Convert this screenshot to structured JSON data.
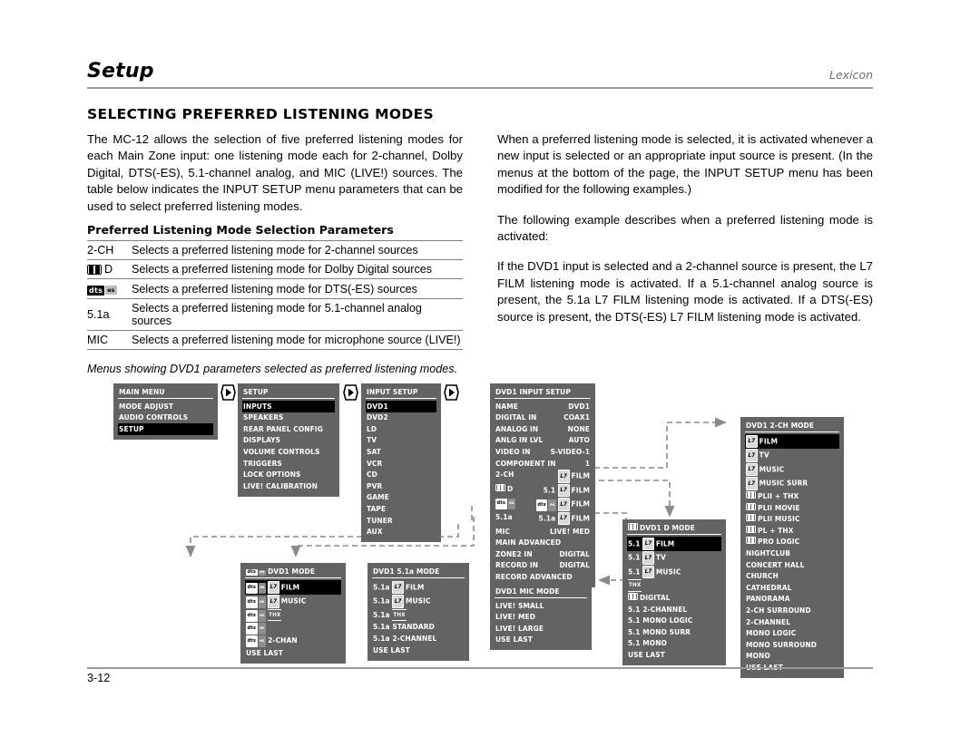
{
  "header": {
    "title": "Setup",
    "brand": "Lexicon"
  },
  "section_heading": "SELECTING PREFERRED LISTENING MODES",
  "body": {
    "left": [
      "The MC-12 allows the selection of five preferred listening modes for each Main Zone input: one listening mode each for 2-channel, Dolby Digital, DTS(-ES), 5.1-channel analog, and MIC (LIVE!) sources. The table below indicates the INPUT SETUP menu parameters that can be used to select preferred listening modes."
    ],
    "right": [
      "When a preferred listening mode is selected, it is activated whenever a new input is selected or an appropriate input source is present. (In the menus at the bottom of the page, the INPUT SETUP menu has been modified for the following examples.)",
      "The following example describes when a preferred listening mode is activated:",
      "If the DVD1 input is selected and a 2-channel source is present, the L7 FILM listening mode is activated. If a 5.1-channel analog source is present, the 5.1a L7 FILM listening mode is activated. If a DTS(-ES) source is present, the DTS(-ES) L7 FILM listening mode is activated."
    ]
  },
  "param_table": {
    "caption": "Preferred Listening Mode Selection Parameters",
    "rows": [
      {
        "key": "2-CH",
        "key_type": "text",
        "desc": "Selects a preferred listening mode for 2-channel sources"
      },
      {
        "key": "D",
        "key_type": "dolby-digital",
        "desc": "Selects a preferred listening mode for Dolby Digital sources"
      },
      {
        "key": "dts",
        "key_type": "dts-es",
        "desc": "Selects a preferred listening mode for DTS(-ES) sources"
      },
      {
        "key": "5.1a",
        "key_type": "text",
        "desc": "Selects a preferred listening mode for 5.1-channel analog sources"
      },
      {
        "key": "MIC",
        "key_type": "text",
        "desc": "Selects a preferred listening mode for microphone source (LIVE!)"
      }
    ]
  },
  "menus_caption": "Menus showing DVD1 parameters selected as preferred listening modes.",
  "menus": {
    "main_menu": {
      "title": "MAIN MENU",
      "items": [
        {
          "label": "MODE ADJUST",
          "selected": false
        },
        {
          "label": "AUDIO CONTROLS",
          "selected": false
        },
        {
          "label": "SETUP",
          "selected": true
        }
      ]
    },
    "setup": {
      "title": "SETUP",
      "items": [
        {
          "label": "INPUTS",
          "selected": true
        },
        {
          "label": "SPEAKERS",
          "selected": false
        },
        {
          "label": "REAR PANEL CONFIG",
          "selected": false
        },
        {
          "label": "DISPLAYS",
          "selected": false
        },
        {
          "label": "VOLUME CONTROLS",
          "selected": false
        },
        {
          "label": "TRIGGERS",
          "selected": false
        },
        {
          "label": "LOCK OPTIONS",
          "selected": false
        },
        {
          "label": "LIVE! CALIBRATION",
          "selected": false
        }
      ]
    },
    "input_setup": {
      "title": "INPUT SETUP",
      "items": [
        {
          "label": "DVD1",
          "selected": true
        },
        {
          "label": "DVD2",
          "selected": false
        },
        {
          "label": "LD",
          "selected": false
        },
        {
          "label": "TV",
          "selected": false
        },
        {
          "label": "SAT",
          "selected": false
        },
        {
          "label": "VCR",
          "selected": false
        },
        {
          "label": "CD",
          "selected": false
        },
        {
          "label": "PVR",
          "selected": false
        },
        {
          "label": "GAME",
          "selected": false
        },
        {
          "label": "TAPE",
          "selected": false
        },
        {
          "label": "TUNER",
          "selected": false
        },
        {
          "label": "AUX",
          "selected": false
        }
      ]
    },
    "dvd1_input_setup": {
      "title": "DVD1 INPUT SETUP",
      "rows": [
        {
          "label": "NAME",
          "value": "DVD1"
        },
        {
          "label": "DIGITAL IN",
          "value": "COAX1"
        },
        {
          "label": "ANALOG IN",
          "value": "NONE"
        },
        {
          "label": "ANLG IN LVL",
          "value": "AUTO"
        },
        {
          "label": "VIDEO IN",
          "value": "S-VIDEO-1"
        },
        {
          "label": "COMPONENT IN",
          "value": "1"
        },
        {
          "label": "2-CH",
          "value": "L7 FILM",
          "value_icon": "l7"
        },
        {
          "label": "D",
          "label_icon": "dolby-digital",
          "value": "5.1 L7 FILM",
          "value_icon": "l7"
        },
        {
          "label": "dts-es",
          "label_icon": "dts-es",
          "value": "dts-es L7 FILM",
          "value_icon": "dts-l7"
        },
        {
          "label": "5.1a",
          "value": "5.1a L7 FILM",
          "value_icon": "l7"
        },
        {
          "label": "MIC",
          "value": "LIVE! MED"
        },
        {
          "label": "MAIN ADVANCED",
          "value": ""
        },
        {
          "label": "ZONE2 IN",
          "value": "DIGITAL"
        },
        {
          "label": "RECORD IN",
          "value": "DIGITAL"
        },
        {
          "label": "RECORD ADVANCED",
          "value": ""
        }
      ]
    },
    "dvd1_2ch_mode": {
      "title": "DVD1 2-CH MODE",
      "items": [
        {
          "label": "FILM",
          "icon": "l7",
          "selected": true
        },
        {
          "label": "TV",
          "icon": "l7",
          "selected": false
        },
        {
          "label": "MUSIC",
          "icon": "l7",
          "selected": false
        },
        {
          "label": "MUSIC SURR",
          "icon": "l7",
          "selected": false
        },
        {
          "label": "PLII + THX",
          "icon": "dolby",
          "selected": false
        },
        {
          "label": "PLII MOVIE",
          "icon": "dolby",
          "selected": false
        },
        {
          "label": "PLII MUSIC",
          "icon": "dolby",
          "selected": false
        },
        {
          "label": "PL + THX",
          "icon": "dolby",
          "selected": false
        },
        {
          "label": "PRO LOGIC",
          "icon": "dolby",
          "selected": false
        },
        {
          "label": "NIGHTCLUB",
          "icon": "",
          "selected": false
        },
        {
          "label": "CONCERT HALL",
          "icon": "",
          "selected": false
        },
        {
          "label": "CHURCH",
          "icon": "",
          "selected": false
        },
        {
          "label": "CATHEDRAL",
          "icon": "",
          "selected": false
        },
        {
          "label": "PANORAMA",
          "icon": "",
          "selected": false
        },
        {
          "label": "2-CH SURROUND",
          "icon": "",
          "selected": false
        },
        {
          "label": "2-CHANNEL",
          "icon": "",
          "selected": false
        },
        {
          "label": "MONO LOGIC",
          "icon": "",
          "selected": false
        },
        {
          "label": "MONO SURROUND",
          "icon": "",
          "selected": false
        },
        {
          "label": "MONO",
          "icon": "",
          "selected": false
        },
        {
          "label": "USE LAST",
          "icon": "",
          "selected": false
        }
      ]
    },
    "dvd1_dd_mode": {
      "title": "DVD1 D MODE",
      "title_icon": "dolby-digital",
      "items": [
        {
          "label": "5.1 FILM",
          "icon": "l7-mid",
          "selected": true
        },
        {
          "label": "5.1 TV",
          "icon": "l7-mid",
          "selected": false
        },
        {
          "label": "5.1 MUSIC",
          "icon": "l7-mid",
          "selected": false
        },
        {
          "label": "THX",
          "icon": "thx-only",
          "selected": false
        },
        {
          "label": "DIGITAL",
          "icon": "dolby",
          "selected": false
        },
        {
          "label": "5.1 2-CHANNEL",
          "icon": "",
          "selected": false
        },
        {
          "label": "5.1 MONO LOGIC",
          "icon": "",
          "selected": false
        },
        {
          "label": "5.1 MONO SURR",
          "icon": "",
          "selected": false
        },
        {
          "label": "5.1 MONO",
          "icon": "",
          "selected": false
        },
        {
          "label": "USE LAST",
          "icon": "",
          "selected": false
        }
      ]
    },
    "dvd1_dts_mode": {
      "title": "DVD1 MODE",
      "title_icon": "dts-es",
      "items": [
        {
          "label": "FILM",
          "icon": "dts-l7",
          "selected": true
        },
        {
          "label": "MUSIC",
          "icon": "dts-l7",
          "selected": false
        },
        {
          "label": "THX",
          "icon": "dts-thx",
          "selected": false
        },
        {
          "label": "",
          "icon": "dts-only",
          "selected": false
        },
        {
          "label": "2-CHAN",
          "icon": "dts",
          "selected": false
        },
        {
          "label": "USE LAST",
          "icon": "",
          "selected": false
        }
      ]
    },
    "dvd1_51a_mode": {
      "title": "DVD1 5.1a MODE",
      "items": [
        {
          "label": "5.1a FILM",
          "icon": "l7-mid",
          "selected": false
        },
        {
          "label": "5.1a MUSIC",
          "icon": "l7-mid",
          "selected": false
        },
        {
          "label": "5.1a THX",
          "icon": "thx-mid",
          "selected": false
        },
        {
          "label": "5.1a STANDARD",
          "icon": "",
          "selected": false
        },
        {
          "label": "5.1a 2-CHANNEL",
          "icon": "",
          "selected": false
        },
        {
          "label": "USE LAST",
          "icon": "",
          "selected": false
        }
      ]
    },
    "dvd1_mic_mode": {
      "title": "DVD1 MIC  MODE",
      "items": [
        {
          "label": "LIVE! SMALL",
          "selected": false
        },
        {
          "label": "LIVE! MED",
          "selected": false
        },
        {
          "label": "LIVE! LARGE",
          "selected": false
        },
        {
          "label": "USE LAST",
          "selected": false
        }
      ]
    }
  },
  "footer": {
    "page": "3-12"
  },
  "colors": {
    "menu_bg": "#636363",
    "menu_selected_bg": "#000000",
    "menu_text": "#ffffff",
    "rule": "#9a9a9a"
  }
}
